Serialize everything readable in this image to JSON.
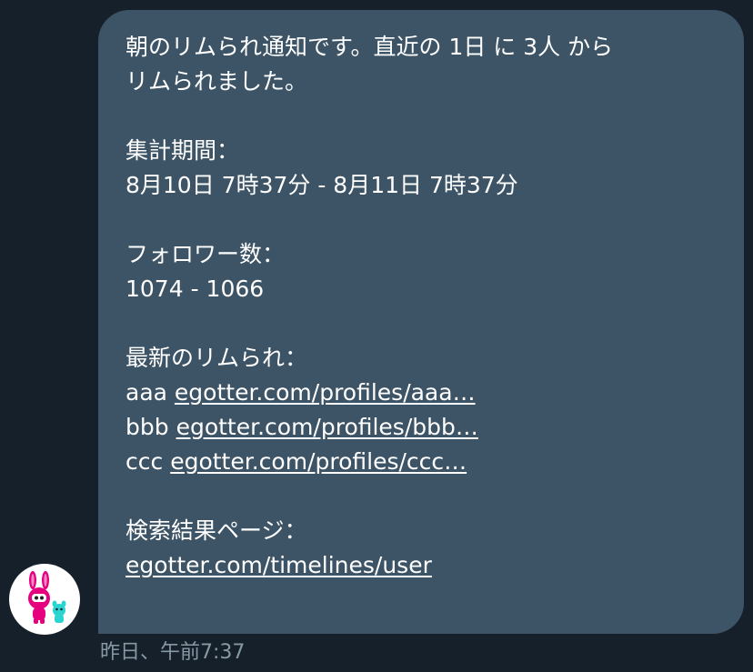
{
  "message": {
    "line1": "朝のリムられ通知です。直近の 1日 に 3人 から",
    "line2": "リムられました。",
    "period_heading": "集計期間：",
    "period_value": "8月10日 7時37分 - 8月11日 7時37分",
    "followers_heading": "フォロワー数：",
    "followers_value": "1074 - 1066",
    "latest_heading": "最新のリムられ：",
    "unfollowers": [
      {
        "name": "aaa",
        "link": "egotter.com/profiles/aaa…"
      },
      {
        "name": "bbb",
        "link": "egotter.com/profiles/bbb…"
      },
      {
        "name": "ccc",
        "link": "egotter.com/profiles/ccc…"
      }
    ],
    "search_heading": "検索結果ページ：",
    "search_link": "egotter.com/timelines/user"
  },
  "timestamp": "昨日、午前7:37",
  "avatar_icon": "bunny-mascot-icon",
  "colors": {
    "background": "#15202b",
    "bubble": "#3d5466",
    "text": "#ffffff",
    "timestamp": "#8899a6"
  }
}
